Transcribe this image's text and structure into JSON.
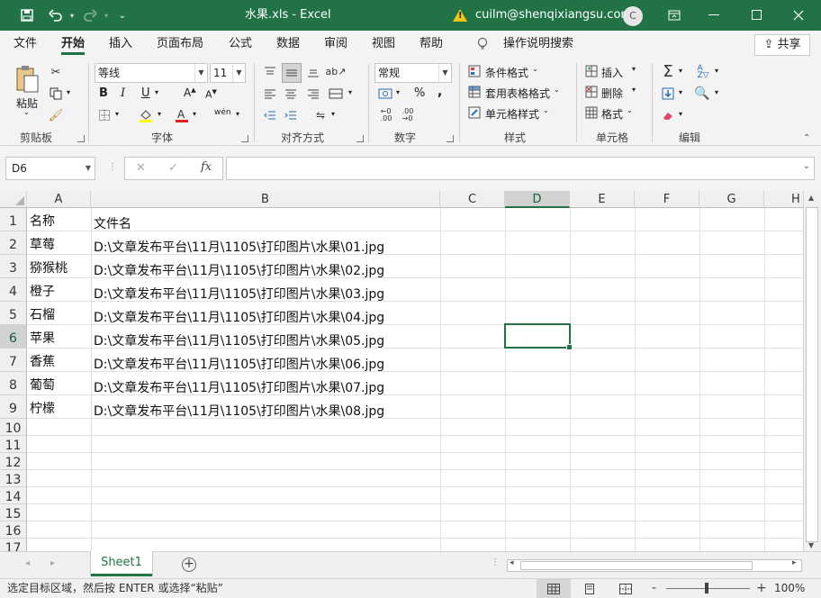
{
  "titlebar": {
    "title": "水果.xls  -  Excel",
    "user": "cuilm@shenqixiangsu.com",
    "avatar": "C",
    "warning_icon": "!"
  },
  "menu": {
    "items": [
      "文件",
      "开始",
      "插入",
      "页面布局",
      "公式",
      "数据",
      "审阅",
      "视图",
      "帮助"
    ],
    "search": "操作说明搜索",
    "share": "共享"
  },
  "ribbon": {
    "clipboard": {
      "paste": "粘贴",
      "label": "剪贴板"
    },
    "font": {
      "name": "等线",
      "size": "11",
      "label": "字体",
      "bold": "B",
      "italic": "I",
      "underline": "U",
      "phonetic": "wén"
    },
    "alignment": {
      "label": "对齐方式"
    },
    "number": {
      "format": "常规",
      "label": "数字",
      "percent": "%",
      "comma": ","
    },
    "styles": {
      "conditional": "条件格式",
      "table": "套用表格格式",
      "cell": "单元格样式",
      "label": "样式"
    },
    "cells": {
      "insert": "插入",
      "delete": "删除",
      "format": "格式",
      "label": "单元格"
    },
    "editing": {
      "label": "编辑"
    }
  },
  "formula_bar": {
    "name_box": "D6",
    "fx": "fx",
    "value": ""
  },
  "grid": {
    "columns": [
      "A",
      "B",
      "C",
      "D",
      "E",
      "F",
      "G",
      "H"
    ],
    "selected_column": "D",
    "selected_row": "6",
    "rows": [
      "1",
      "2",
      "3",
      "4",
      "5",
      "6",
      "7",
      "8",
      "9",
      "10",
      "11",
      "12",
      "13",
      "14",
      "15",
      "16",
      "17"
    ],
    "data": [
      [
        "名称",
        "文件名"
      ],
      [
        "草莓",
        "D:\\文章发布平台\\11月\\1105\\打印图片\\水果\\01.jpg"
      ],
      [
        "猕猴桃",
        "D:\\文章发布平台\\11月\\1105\\打印图片\\水果\\02.jpg"
      ],
      [
        "橙子",
        "D:\\文章发布平台\\11月\\1105\\打印图片\\水果\\03.jpg"
      ],
      [
        "石榴",
        "D:\\文章发布平台\\11月\\1105\\打印图片\\水果\\04.jpg"
      ],
      [
        "苹果",
        "D:\\文章发布平台\\11月\\1105\\打印图片\\水果\\05.jpg"
      ],
      [
        "香蕉",
        "D:\\文章发布平台\\11月\\1105\\打印图片\\水果\\06.jpg"
      ],
      [
        "葡萄",
        "D:\\文章发布平台\\11月\\1105\\打印图片\\水果\\07.jpg"
      ],
      [
        "柠檬",
        "D:\\文章发布平台\\11月\\1105\\打印图片\\水果\\08.jpg"
      ]
    ]
  },
  "sheets": {
    "active": "Sheet1",
    "add": "+"
  },
  "status": {
    "message": "选定目标区域，然后按 ENTER 或选择“粘贴”",
    "zoom": "100%",
    "zoom_out": "-",
    "zoom_in": "+"
  },
  "colors": {
    "accent": "#217346",
    "selection": "#217346"
  }
}
